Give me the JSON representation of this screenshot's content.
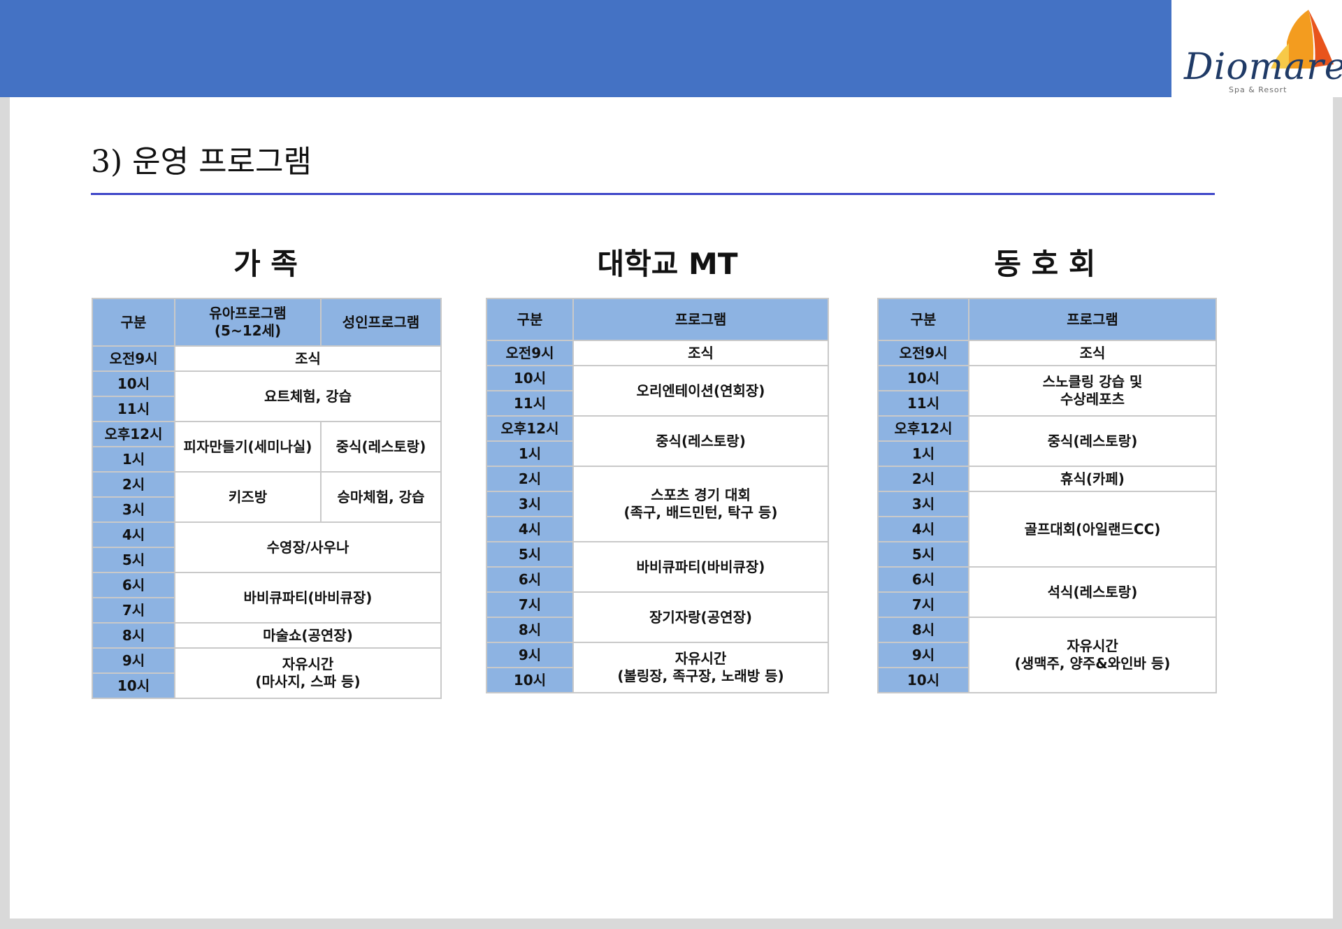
{
  "header": {
    "bar_color": "#4472c4"
  },
  "logo": {
    "name": "Diomare",
    "sub": "Spa & Resort"
  },
  "page": {
    "title": "3) 운영 프로그램"
  },
  "family": {
    "title": "가   족",
    "headers": [
      "구분",
      "유아프로그램\n(5~12세)",
      "성인프로그램"
    ],
    "times": [
      "오전9시",
      "10시",
      "11시",
      "오후12시",
      "1시",
      "2시",
      "3시",
      "4시",
      "5시",
      "6시",
      "7시",
      "8시",
      "9시",
      "10시"
    ],
    "cells": {
      "breakfast": "조식",
      "yoga": "요트체험, 강습",
      "pizza": "피자만들기(세미나실)",
      "lunch": "중식(레스토랑)",
      "kids": "키즈방",
      "horse": "승마체험, 강습",
      "pool": "수영장/사우나",
      "bbq": "바비큐파티(바비큐장)",
      "magic": "마술쇼(공연장)",
      "free": "자유시간\n(마사지, 스파 등)"
    }
  },
  "mt": {
    "title": "대학교 MT",
    "headers": [
      "구분",
      "프로그램"
    ],
    "times": [
      "오전9시",
      "10시",
      "11시",
      "오후12시",
      "1시",
      "2시",
      "3시",
      "4시",
      "5시",
      "6시",
      "7시",
      "8시",
      "9시",
      "10시"
    ],
    "cells": {
      "breakfast": "조식",
      "orientation": "오리엔테이션(연회장)",
      "lunch": "중식(레스토랑)",
      "sports": "스포츠 경기 대회\n(족구, 배드민턴, 탁구 등)",
      "bbq": "바비큐파티(바비큐장)",
      "talent": "장기자랑(공연장)",
      "free": "자유시간\n(볼링장, 족구장, 노래방 등)"
    }
  },
  "club": {
    "title": "동 호 회",
    "headers": [
      "구분",
      "프로그램"
    ],
    "times": [
      "오전9시",
      "10시",
      "11시",
      "오후12시",
      "1시",
      "2시",
      "3시",
      "4시",
      "5시",
      "6시",
      "7시",
      "8시",
      "9시",
      "10시"
    ],
    "cells": {
      "breakfast": "조식",
      "snorkel": "스노클링 강습 및\n수상레포츠",
      "lunch": "중식(레스토랑)",
      "rest": "휴식(카페)",
      "golf": "골프대회(아일랜드CC)",
      "dinner": "석식(레스토랑)",
      "free": "자유시간\n(생맥주, 양주&와인바 등)"
    }
  }
}
